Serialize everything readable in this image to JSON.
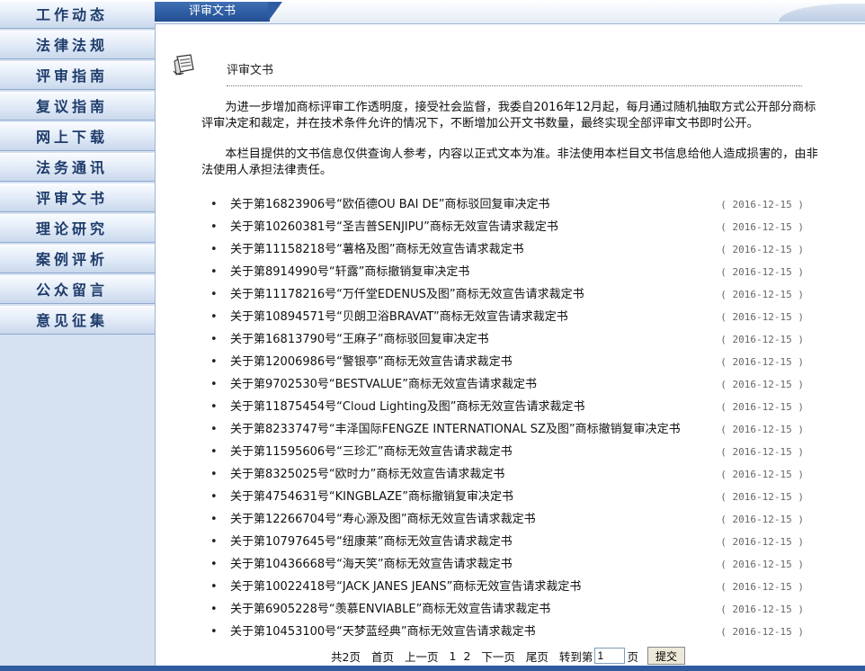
{
  "sidebar": {
    "items": [
      {
        "label": "工作动态"
      },
      {
        "label": "法律法规"
      },
      {
        "label": "评审指南"
      },
      {
        "label": "复议指南"
      },
      {
        "label": "网上下载"
      },
      {
        "label": "法务通讯"
      },
      {
        "label": "评审文书"
      },
      {
        "label": "理论研究"
      },
      {
        "label": "案例评析"
      },
      {
        "label": "公众留言"
      },
      {
        "label": "意见征集"
      }
    ]
  },
  "header": {
    "tab_label": "评审文书"
  },
  "section": {
    "title": "评审文书"
  },
  "intro": {
    "p1": "为进一步增加商标评审工作透明度，接受社会监督，我委自2016年12月起，每月通过随机抽取方式公开部分商标评审决定和裁定，并在技术条件允许的情况下，不断增加公开文书数量，最终实现全部评审文书即时公开。",
    "p2": "本栏目提供的文书信息仅供查询人参考，内容以正式文本为准。非法使用本栏目文书信息给他人造成损害的，由非法使用人承担法律责任。"
  },
  "documents": [
    {
      "title": "关于第16823906号“欧佰德OU BAI DE”商标驳回复审决定书",
      "date": "( 2016-12-15 )"
    },
    {
      "title": "关于第10260381号“圣吉普SENJIPU”商标无效宣告请求裁定书",
      "date": "( 2016-12-15 )"
    },
    {
      "title": "关于第11158218号“薯格及图”商标无效宣告请求裁定书",
      "date": "( 2016-12-15 )"
    },
    {
      "title": "关于第8914990号“轩露”商标撤销复审决定书",
      "date": "( 2016-12-15 )"
    },
    {
      "title": "关于第11178216号“万仟堂EDENUS及图”商标无效宣告请求裁定书",
      "date": "( 2016-12-15 )"
    },
    {
      "title": "关于第10894571号“贝朗卫浴BRAVAT”商标无效宣告请求裁定书",
      "date": "( 2016-12-15 )"
    },
    {
      "title": "关于第16813790号“王麻子”商标驳回复审决定书",
      "date": "( 2016-12-15 )"
    },
    {
      "title": "关于第12006986号“警银亭”商标无效宣告请求裁定书",
      "date": "( 2016-12-15 )"
    },
    {
      "title": "关于第9702530号“BESTVALUE”商标无效宣告请求裁定书",
      "date": "( 2016-12-15 )"
    },
    {
      "title": "关于第11875454号“Cloud Lighting及图”商标无效宣告请求裁定书",
      "date": "( 2016-12-15 )"
    },
    {
      "title": "关于第8233747号“丰泽国际FENGZE INTERNATIONAL SZ及图”商标撤销复审决定书",
      "date": "( 2016-12-15 )"
    },
    {
      "title": "关于第11595606号“三珍汇”商标无效宣告请求裁定书",
      "date": "( 2016-12-15 )"
    },
    {
      "title": "关于第8325025号“欧时力”商标无效宣告请求裁定书",
      "date": "( 2016-12-15 )"
    },
    {
      "title": "关于第4754631号“KINGBLAZE”商标撤销复审决定书",
      "date": "( 2016-12-15 )"
    },
    {
      "title": "关于第12266704号“寿心源及图”商标无效宣告请求裁定书",
      "date": "( 2016-12-15 )"
    },
    {
      "title": "关于第10797645号“纽康莱”商标无效宣告请求裁定书",
      "date": "( 2016-12-15 )"
    },
    {
      "title": "关于第10436668号“海天笑”商标无效宣告请求裁定书",
      "date": "( 2016-12-15 )"
    },
    {
      "title": "关于第10022418号“JACK JANES JEANS”商标无效宣告请求裁定书",
      "date": "( 2016-12-15 )"
    },
    {
      "title": "关于第6905228号“羡慕ENVIABLE”商标无效宣告请求裁定书",
      "date": "( 2016-12-15 )"
    },
    {
      "title": "关于第10453100号“天梦蓝经典”商标无效宣告请求裁定书",
      "date": "( 2016-12-15 )"
    }
  ],
  "pager": {
    "total": "共2页",
    "first": "首页",
    "prev": "上一页",
    "page1": "1",
    "page2": "2",
    "next": "下一页",
    "last": "尾页",
    "goto": "转到第",
    "page_value": "1",
    "page_suffix": "页",
    "submit": "提交"
  },
  "colors": {
    "nav_text": "#1f3c6b",
    "tab_bg": "#2e5ca1",
    "sidebar_bg": "#d6e2f1"
  }
}
